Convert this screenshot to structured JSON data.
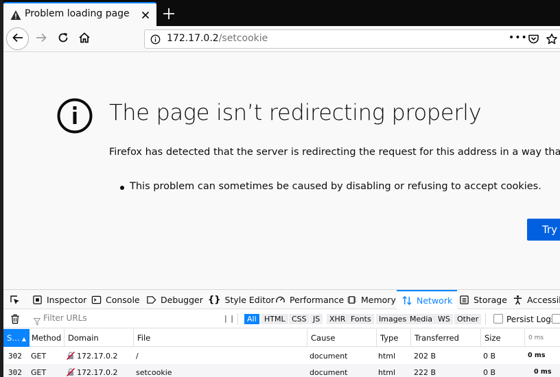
{
  "browser": {
    "tab": {
      "title": "Problem loading page",
      "icon": "warning-icon"
    },
    "url": {
      "host": "172.17.0.2",
      "path": "/setcookie",
      "more_label": "•••"
    }
  },
  "error_page": {
    "title": "The page isn’t redirecting properly",
    "description": "Firefox has detected that the server is redirecting the request for this address in a way that will never c",
    "bullet": "This problem can sometimes be caused by disabling or refusing to accept cookies.",
    "try_again": "Try a"
  },
  "devtools": {
    "tabs": [
      {
        "label": "Inspector",
        "icon": "inspector-icon"
      },
      {
        "label": "Console",
        "icon": "console-icon"
      },
      {
        "label": "Debugger",
        "icon": "debugger-icon"
      },
      {
        "label": "Style Editor",
        "icon": "braces-icon"
      },
      {
        "label": "Performance",
        "icon": "gauge-icon"
      },
      {
        "label": "Memory",
        "icon": "memory-icon"
      },
      {
        "label": "Network",
        "icon": "network-arrows-icon",
        "selected": true
      },
      {
        "label": "Storage",
        "icon": "storage-icon"
      },
      {
        "label": "Accessibi",
        "icon": "accessibility-icon"
      }
    ],
    "filter_placeholder": "Filter URLs",
    "pause_label": "| |",
    "type_filters": [
      "All",
      "HTML",
      "CSS",
      "JS",
      "XHR",
      "Fonts",
      "Images",
      "Media",
      "WS",
      "Other"
    ],
    "selected_type": "All",
    "persist_logs": "Persist Logs",
    "columns": [
      "S…",
      "Method",
      "Domain",
      "File",
      "Cause",
      "Type",
      "Transferred",
      "Size",
      "0 ms"
    ],
    "requests": [
      {
        "status": "302",
        "method": "GET",
        "domain": "172.17.0.2",
        "file": "/",
        "cause": "document",
        "type": "html",
        "transferred": "202 B",
        "size": "0 B",
        "time": "0 ms"
      },
      {
        "status": "302",
        "method": "GET",
        "domain": "172.17.0.2",
        "file": "setcookie",
        "cause": "document",
        "type": "html",
        "transferred": "222 B",
        "size": "0 B",
        "time": "0 ms"
      }
    ]
  },
  "colors": {
    "accent": "#0a84ff",
    "primary_button": "#0060df",
    "tab_strip": "#0c0c0d"
  }
}
